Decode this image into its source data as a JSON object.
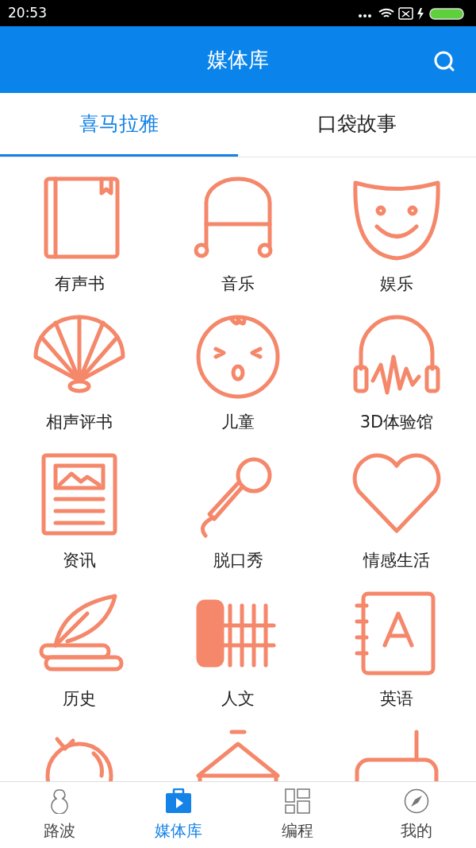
{
  "status_bar": {
    "time": "20:53"
  },
  "header": {
    "title": "媒体库"
  },
  "tabs": [
    {
      "label": "喜马拉雅",
      "selected": true
    },
    {
      "label": "口袋故事",
      "selected": false
    }
  ],
  "categories": [
    {
      "label": "有声书"
    },
    {
      "label": "音乐"
    },
    {
      "label": "娱乐"
    },
    {
      "label": "相声评书"
    },
    {
      "label": "儿童"
    },
    {
      "label": "3D体验馆"
    },
    {
      "label": "资讯"
    },
    {
      "label": "脱口秀"
    },
    {
      "label": "情感生活"
    },
    {
      "label": "历史"
    },
    {
      "label": "人文"
    },
    {
      "label": "英语"
    }
  ],
  "bottom_nav": [
    {
      "label": "路波",
      "selected": false
    },
    {
      "label": "媒体库",
      "selected": true
    },
    {
      "label": "编程",
      "selected": false
    },
    {
      "label": "我的",
      "selected": false
    }
  ]
}
